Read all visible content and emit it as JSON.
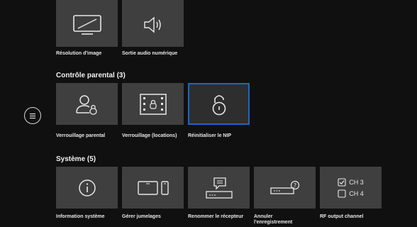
{
  "top_row": {
    "tiles": [
      {
        "label": "Résolution d'image",
        "icon": "monitor-resolution-icon"
      },
      {
        "label": "Sortie audio numérique",
        "icon": "speaker-icon"
      }
    ]
  },
  "parental": {
    "title": "Contrôle parental (3)",
    "tiles": [
      {
        "label": "Verrouillage parental",
        "icon": "user-lock-icon"
      },
      {
        "label": "Verrouillage (locations)",
        "icon": "film-lock-icon"
      },
      {
        "label": "Réinitialiser le NIP",
        "icon": "unlocked-padlock-icon"
      }
    ]
  },
  "system": {
    "title": "Système (5)",
    "tiles": [
      {
        "label": "Information système",
        "icon": "info-icon"
      },
      {
        "label": "Gérer jumelages",
        "icon": "tablet-phone-icon"
      },
      {
        "label": "Renommer le récepteur",
        "icon": "receiver-message-icon"
      },
      {
        "label": "Annuler l'enregistrement",
        "icon": "receiver-question-icon"
      },
      {
        "label": "RF output channel",
        "icon": "checkbox-channel-icon",
        "options": [
          "CH 3",
          "CH 4"
        ]
      }
    ]
  },
  "colors": {
    "background": "#101010",
    "tile": "#3f3f3f",
    "selected_border": "#1f66c1"
  }
}
